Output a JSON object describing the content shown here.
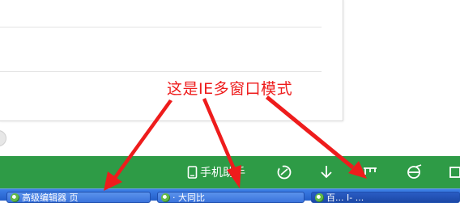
{
  "annotation": {
    "text": "这是IE多窗口模式",
    "color": "#ee1c1c"
  },
  "toolbar": {
    "background": "#2e9b46",
    "mobile_label": "手机助手",
    "mobile_icon": "phone-icon",
    "items": [
      {
        "name": "speed-icon"
      },
      {
        "name": "download-icon"
      },
      {
        "name": "window-mode-icon"
      },
      {
        "name": "ie-icon"
      },
      {
        "name": "window-icon"
      }
    ]
  },
  "taskbar": {
    "buttons": [
      {
        "label": "高级编辑器 页",
        "active": false
      },
      {
        "label": "  ·   大同比",
        "active": false
      },
      {
        "label": "百...    I- ...",
        "active": true
      }
    ]
  }
}
